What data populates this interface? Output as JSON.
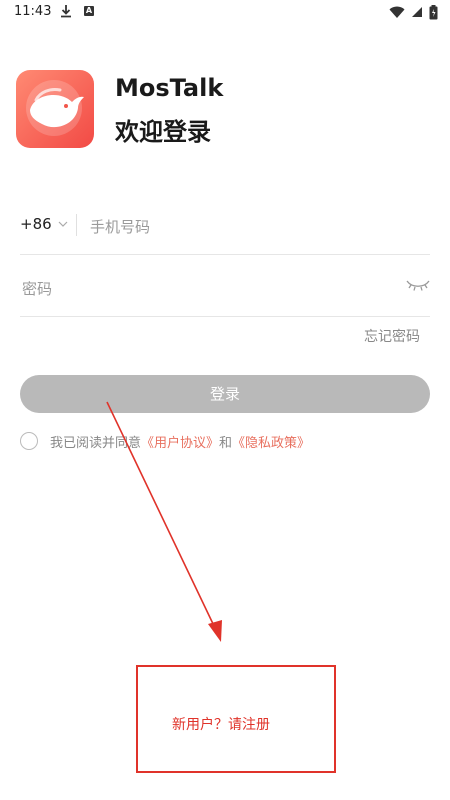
{
  "status_bar": {
    "time": "11:43",
    "icons": [
      "download-icon",
      "a-notification-icon",
      "wifi-icon",
      "signal-icon",
      "battery-icon"
    ]
  },
  "header": {
    "app_name": "MosTalk",
    "welcome": "欢迎登录",
    "logo_icon": "whale-logo-icon"
  },
  "form": {
    "country_code": "+86",
    "phone_placeholder": "手机号码",
    "password_placeholder": "密码",
    "forgot_password": "忘记密码",
    "login_label": "登录"
  },
  "agreement": {
    "prefix": "我已阅读并同意",
    "user_agreement": "《用户协议》",
    "and": "和",
    "privacy_policy": "《隐私政策》"
  },
  "register": {
    "label": "新用户？请注册"
  },
  "colors": {
    "accent": "#e8705f",
    "annotation_red": "#e0332a",
    "login_disabled": "#b9b9b9"
  }
}
